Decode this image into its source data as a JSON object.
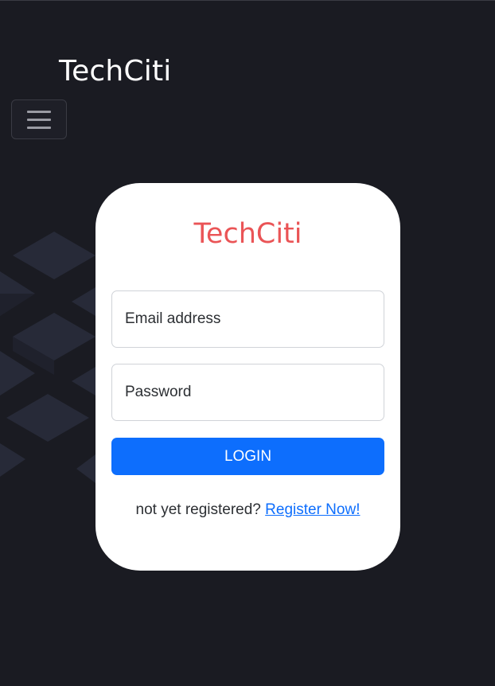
{
  "navbar": {
    "brand": "TechCiti"
  },
  "login_card": {
    "title": "TechCiti",
    "email_placeholder": "Email address",
    "password_placeholder": "Password",
    "login_label": "LOGIN",
    "register_prompt": "not yet registered?",
    "register_link": "Register Now!"
  },
  "colors": {
    "background": "#1a1b22",
    "brand_red": "#ea5456",
    "primary_blue": "#0d6efd",
    "card": "#ffffff"
  },
  "icons": {
    "menu": "hamburger-icon"
  }
}
